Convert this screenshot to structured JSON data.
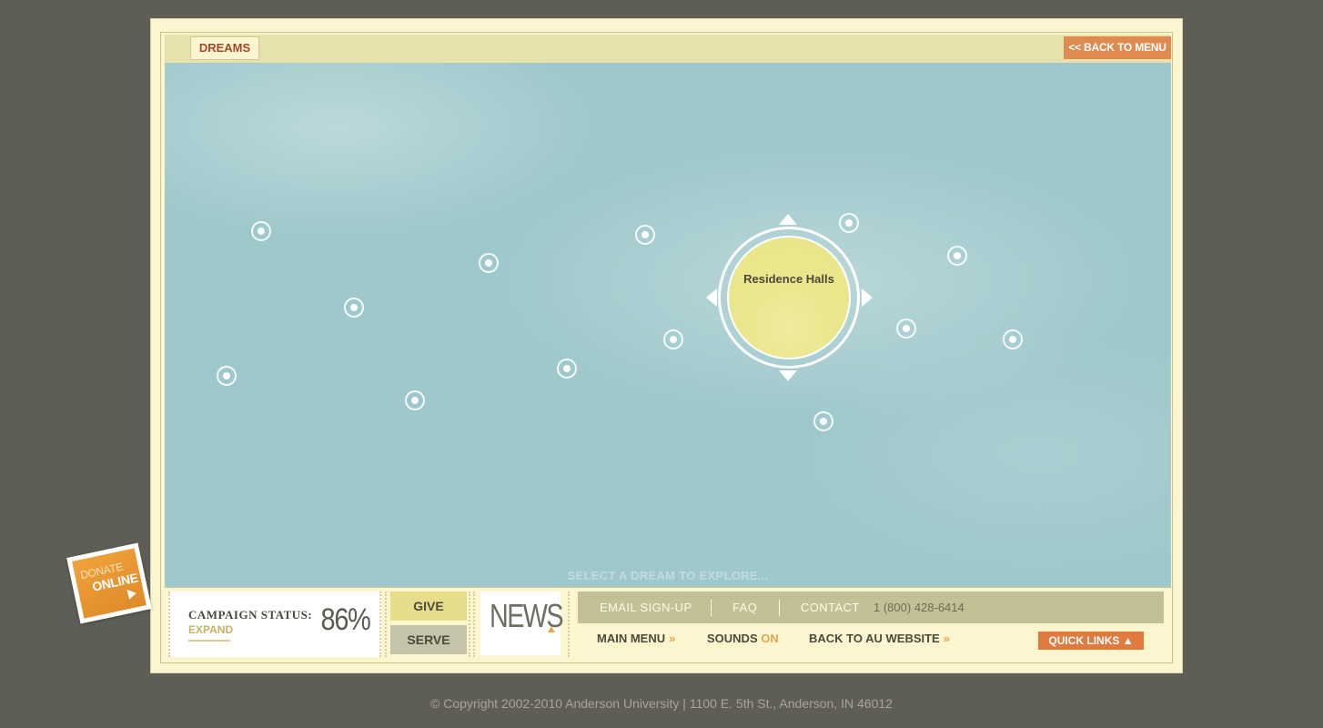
{
  "header": {
    "tab_label": "DREAMS",
    "back_label": "<< BACK TO MENU"
  },
  "map": {
    "focus_label": "Residence Halls",
    "prompt": "SELECT A DREAM TO EXPLORE..."
  },
  "campaign": {
    "title": "CAMPAIGN STATUS:",
    "expand_label": "EXPAND",
    "percent": "86%"
  },
  "actions": {
    "give_label": "GIVE",
    "serve_label": "SERVE"
  },
  "news": {
    "label": "NEWS"
  },
  "links": {
    "email_label": "EMAIL SIGN-UP",
    "faq_label": "FAQ",
    "contact_label": "CONTACT",
    "phone": "1 (800) 428-6414",
    "main_menu_label": "MAIN MENU",
    "sounds_label": "SOUNDS",
    "sounds_state": "ON",
    "au_website_label": "BACK TO AU WEBSITE",
    "chevron": "»",
    "quick_links_label": "QUICK LINKS ▲"
  },
  "donate": {
    "line1": "DONATE",
    "line2": "ONLINE"
  },
  "footer": {
    "text": "© Copyright 2002-2010 Anderson University   |  1100 E. 5th St., Anderson, IN 46012"
  },
  "colors": {
    "sky": "#9ec8cb",
    "frame": "#fbf6cf",
    "accent_orange": "#e08a4f",
    "focus_yellow": "#eae68d",
    "page_background": "#5f5e56"
  }
}
